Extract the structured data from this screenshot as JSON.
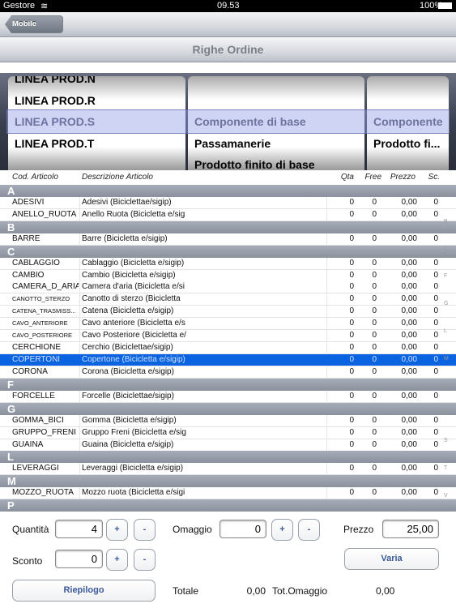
{
  "status_bar": {
    "carrier": "Gestore",
    "time": "09.53",
    "battery": "100%"
  },
  "nav": {
    "back_label": "Mobile Orders",
    "title": "Righe Ordine"
  },
  "picker": {
    "col1": [
      "LINEA PROD.N",
      "LINEA PROD.R",
      "LINEA PROD.S",
      "LINEA PROD.T"
    ],
    "col2": [
      "",
      "",
      "Componente di base",
      "Passamanerie",
      "Prodotto finito di base"
    ],
    "col3": [
      "",
      "",
      "Componente",
      "Prodotto fi..."
    ],
    "selected_index": 2
  },
  "table": {
    "headers": {
      "code": "Cod. Articolo",
      "desc": "Descrizione Articolo",
      "qta": "Qta",
      "free": "Free",
      "price": "Prezzo",
      "sc": "Sc."
    },
    "rows": [
      {
        "section": "A"
      },
      {
        "code": "ADESIVI",
        "desc": "Adesivi (Biciclettae/sigip)",
        "qta": "0",
        "free": "0",
        "price": "0,00",
        "sc": "0"
      },
      {
        "code": "ANELLO_RUOTA",
        "desc": "Anello Ruota (Bicicletta e/sig",
        "qta": "0",
        "free": "0",
        "price": "0,00",
        "sc": "0"
      },
      {
        "section": "B"
      },
      {
        "code": "BARRE",
        "desc": "Barre (Bicicletta e/sigip)",
        "qta": "0",
        "free": "0",
        "price": "0,00",
        "sc": "0"
      },
      {
        "section": "C"
      },
      {
        "code": "CABLAGGIO",
        "desc": "Cablaggio (Bicicletta e/sigip)",
        "qta": "0",
        "free": "0",
        "price": "0,00",
        "sc": "0"
      },
      {
        "code": "CAMBIO",
        "desc": "Cambio (Bicicletta e/sigip)",
        "qta": "0",
        "free": "0",
        "price": "0,00",
        "sc": "0"
      },
      {
        "code": "CAMERA_D_ARIA",
        "desc": "Camera d'aria (Bicicletta e/si",
        "qta": "0",
        "free": "0",
        "price": "0,00",
        "sc": "0"
      },
      {
        "code": "CANOTTO_STERZO",
        "desc": "Canotto di sterzo (Bicicletta",
        "qta": "0",
        "free": "0",
        "price": "0,00",
        "sc": "0",
        "small": true
      },
      {
        "code": "CATENA_TRASMISS...",
        "desc": "Catena (Bicicletta e/sigip)",
        "qta": "0",
        "free": "0",
        "price": "0,00",
        "sc": "0",
        "small": true
      },
      {
        "code": "CAVO_ANTERIORE",
        "desc": "Cavo anteriore (Bicicletta e/s",
        "qta": "0",
        "free": "0",
        "price": "0,00",
        "sc": "0",
        "small": true
      },
      {
        "code": "CAVO_POSTERIORE",
        "desc": "Cavo Posteriore (Bicicletta e/",
        "qta": "0",
        "free": "0",
        "price": "0,00",
        "sc": "0",
        "small": true
      },
      {
        "code": "CERCHIONE",
        "desc": "Cerchio  (Biciclettae/sigip)",
        "qta": "0",
        "free": "0",
        "price": "0,00",
        "sc": "0"
      },
      {
        "code": "COPERTONI",
        "desc": "Copertone (Bicicletta e/sigip)",
        "qta": "0",
        "free": "0",
        "price": "0,00",
        "sc": "0",
        "selected": true
      },
      {
        "code": "CORONA",
        "desc": "Corona (Bicicletta e/sigip)",
        "qta": "0",
        "free": "0",
        "price": "0,00",
        "sc": "0"
      },
      {
        "section": "F"
      },
      {
        "code": "FORCELLE",
        "desc": "Forcelle (Biciclettae/sigip)",
        "qta": "0",
        "free": "0",
        "price": "0,00",
        "sc": "0"
      },
      {
        "section": "G"
      },
      {
        "code": "GOMMA_BICI",
        "desc": "Gomma (Bicicletta e/sigip)",
        "qta": "0",
        "free": "0",
        "price": "0,00",
        "sc": "0"
      },
      {
        "code": "GRUPPO_FRENI",
        "desc": "Gruppo Freni (Bicicletta e/sig",
        "qta": "0",
        "free": "0",
        "price": "0,00",
        "sc": "0"
      },
      {
        "code": "GUAINA",
        "desc": "Guaina (Bicicletta e/sigip)",
        "qta": "0",
        "free": "0",
        "price": "0,00",
        "sc": "0"
      },
      {
        "section": "L"
      },
      {
        "code": "LEVERAGGI",
        "desc": "Leveraggi (Bicicletta e/sigip)",
        "qta": "0",
        "free": "0",
        "price": "0,00",
        "sc": "0"
      },
      {
        "section": "M"
      },
      {
        "code": "MOZZO_RUOTA",
        "desc": "Mozzo ruota (Bicicletta e/sigi",
        "qta": "0",
        "free": "0",
        "price": "0,00",
        "sc": "0"
      },
      {
        "section": "P"
      }
    ],
    "index": [
      "A",
      "B",
      "C",
      "F",
      "G",
      "L",
      "M",
      "P",
      "R",
      "S",
      "T",
      "V"
    ]
  },
  "form": {
    "quantita_label": "Quantità",
    "quantita": "4",
    "omaggio_label": "Omaggio",
    "omaggio": "0",
    "prezzo_label": "Prezzo",
    "prezzo": "25,00",
    "sconto_label": "Sconto",
    "sconto": "0",
    "plus": "+",
    "minus": "-",
    "varia": "Varia",
    "riepilogo": "Riepilogo",
    "totale_label": "Totale",
    "totale": "0,00",
    "tot_omaggio_label": "Tot.Omaggio",
    "tot_omaggio": "0,00"
  }
}
